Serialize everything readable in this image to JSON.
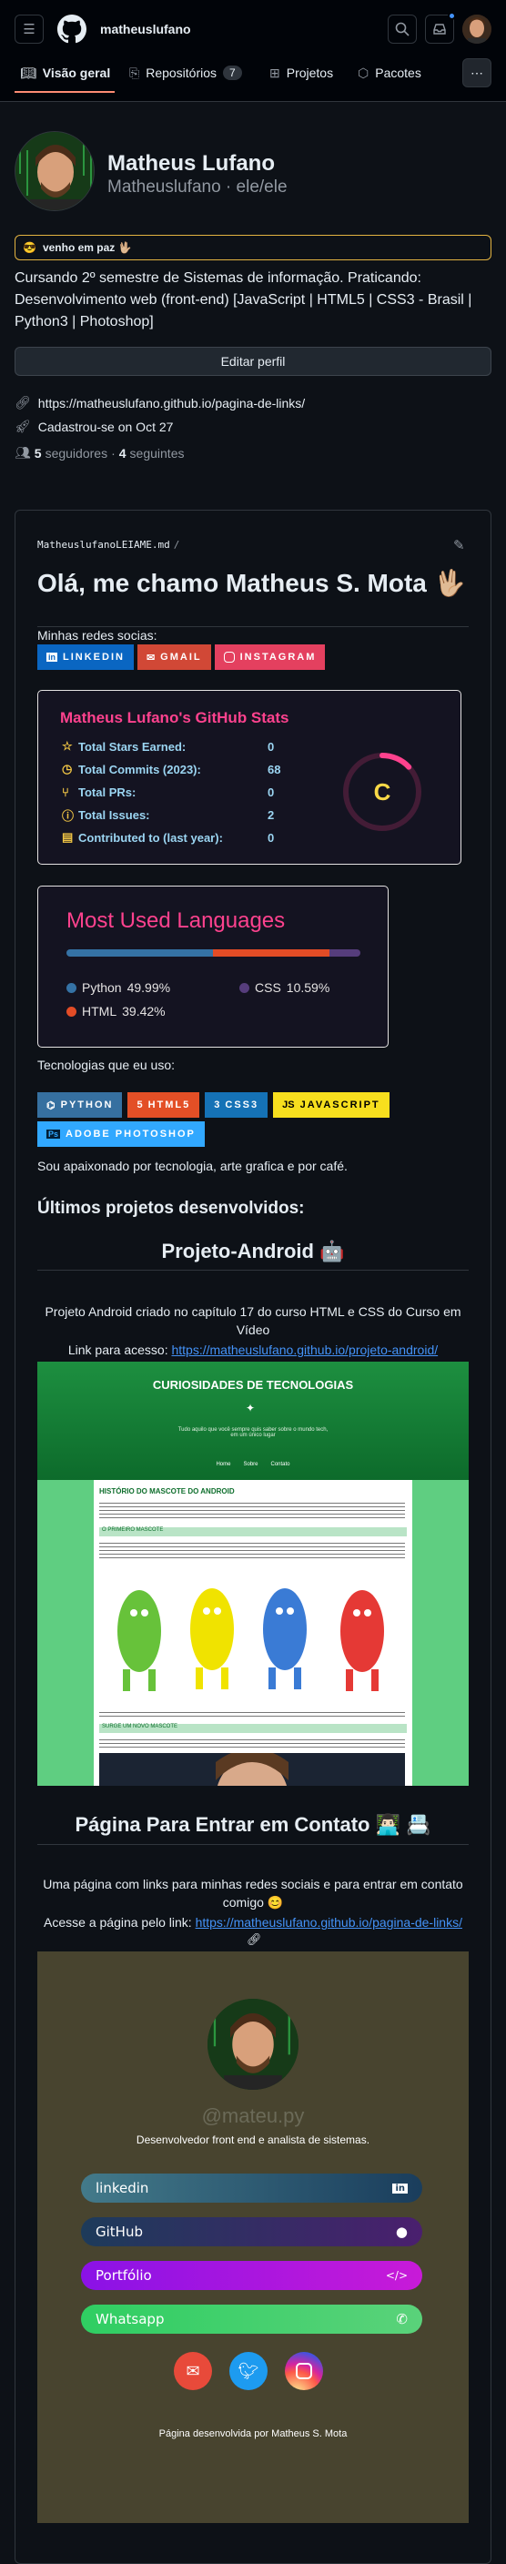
{
  "header": {
    "username": "matheuslufano",
    "tabs": [
      {
        "label": "Visão geral",
        "icon": "book-open-icon",
        "active": true
      },
      {
        "label": "Repositórios",
        "icon": "repo-icon",
        "count": "7"
      },
      {
        "label": "Projetos",
        "icon": "table-icon"
      },
      {
        "label": "Pacotes",
        "icon": "package-icon"
      }
    ]
  },
  "profile": {
    "name": "Matheus Lufano",
    "login_line": "Matheuslufano · ele/ele",
    "status_emoji": "😎",
    "status": "venho em paz 🖖🏼",
    "bio": "Cursando 2º semestre de Sistemas de informação. Praticando: Desenvolvimento web (front-end) [JavaScript | HTML5 | CSS3 - Brasil | Python3 | Photoshop]",
    "edit_button": "Editar perfil",
    "link": "https://matheuslufano.github.io/pagina-de-links/",
    "joined": "Cadastrou-se on Oct 27",
    "followers_count": "5",
    "followers_label": "seguidores",
    "following_count": "4",
    "following_label": "seguintes"
  },
  "readme": {
    "path": "MatheuslufanoLEIAME.md",
    "path_sep": "/",
    "heading": "Olá, me chamo Matheus S. Mota 🖖🏼",
    "socials_label": "Minhas redes socias:",
    "socials": [
      {
        "label": "LINKEDIN",
        "color": "#0a66c2"
      },
      {
        "label": "GMAIL",
        "color": "#d14836"
      },
      {
        "label": "INSTAGRAM",
        "color": "#e4405f"
      }
    ],
    "stats": {
      "title": "Matheus Lufano's GitHub Stats",
      "rows": [
        {
          "label": "Total Stars Earned:",
          "value": "0",
          "icon": "star-icon"
        },
        {
          "label": "Total Commits (2023):",
          "value": "68",
          "icon": "history-icon"
        },
        {
          "label": "Total PRs:",
          "value": "0",
          "icon": "pull-request-icon"
        },
        {
          "label": "Total Issues:",
          "value": "2",
          "icon": "issue-icon"
        },
        {
          "label": "Contributed to (last year):",
          "value": "0",
          "icon": "repo-icon"
        }
      ],
      "rank": "C",
      "rank_progress": 0.13,
      "title_color": "#fe428e",
      "accent_color": "#f8d847"
    },
    "languages": {
      "title": "Most Used Languages",
      "items": [
        {
          "name": "Python",
          "percent": "49.99%",
          "value": 49.99,
          "color": "#3572a5"
        },
        {
          "name": "HTML",
          "percent": "39.42%",
          "value": 39.42,
          "color": "#e34c26"
        },
        {
          "name": "CSS",
          "percent": "10.59%",
          "value": 10.59,
          "color": "#563d7c"
        }
      ]
    },
    "tech_label": "Tecnologias que eu uso:",
    "techs": [
      {
        "label": "PYTHON",
        "color": "#3670a0",
        "fg": "#ffffff"
      },
      {
        "label": "HTML5",
        "color": "#e34f26",
        "fg": "#ffffff"
      },
      {
        "label": "CSS3",
        "color": "#1572b6",
        "fg": "#ffffff"
      },
      {
        "label": "JAVASCRIPT",
        "color": "#f7df1e",
        "fg": "#000000"
      },
      {
        "label": "ADOBE PHOTOSHOP",
        "color": "#31a8ff",
        "fg": "#ffffff"
      }
    ],
    "passion": "Sou apaixonado por tecnologia, arte grafica e por café.",
    "projects_heading": "Últimos projetos desenvolvidos:",
    "project1": {
      "title": "Projeto-Android 🤖",
      "desc": "Projeto Android criado no capítulo 17 do curso HTML e CSS do Curso em Vídeo",
      "link_prefix": "Link para acesso:",
      "link": "https://matheuslufano.github.io/projeto-android/",
      "preview": {
        "site_title": "CURIOSIDADES DE TECNOLOGIAS",
        "site_sub": "Tudo aquilo que você sempre quis saber sobre o mundo tech, em um único lugar",
        "nav": [
          "Home",
          "Sobre",
          "Contato"
        ],
        "article_title": "HISTÓRIO DO MASCOTE DO ANDROID",
        "section1": "O PRIMEIRO MASCOTE",
        "section2": "SURGE UM NOVO MASCOTE"
      }
    },
    "project2": {
      "title": "Página Para Entrar em Contato 👨🏻‍💻 📇",
      "desc": "Uma página com links para minhas redes sociais e para entrar em contato comigo 😊",
      "link_prefix": "Acesse a página pelo link:",
      "link": "https://matheuslufano.github.io/pagina-de-links/",
      "preview": {
        "handle": "@mateu.py",
        "role": "Desenvolvedor front end e analista de sistemas.",
        "buttons": [
          {
            "label": "linkedin",
            "icon": "linkedin-icon"
          },
          {
            "label": "GitHub",
            "icon": "github-icon"
          },
          {
            "label": "Portfólio",
            "icon": "code-icon"
          },
          {
            "label": "Whatsapp",
            "icon": "whatsapp-icon"
          }
        ],
        "footer": "Página desenvolvida por Matheus S. Mota"
      }
    }
  }
}
